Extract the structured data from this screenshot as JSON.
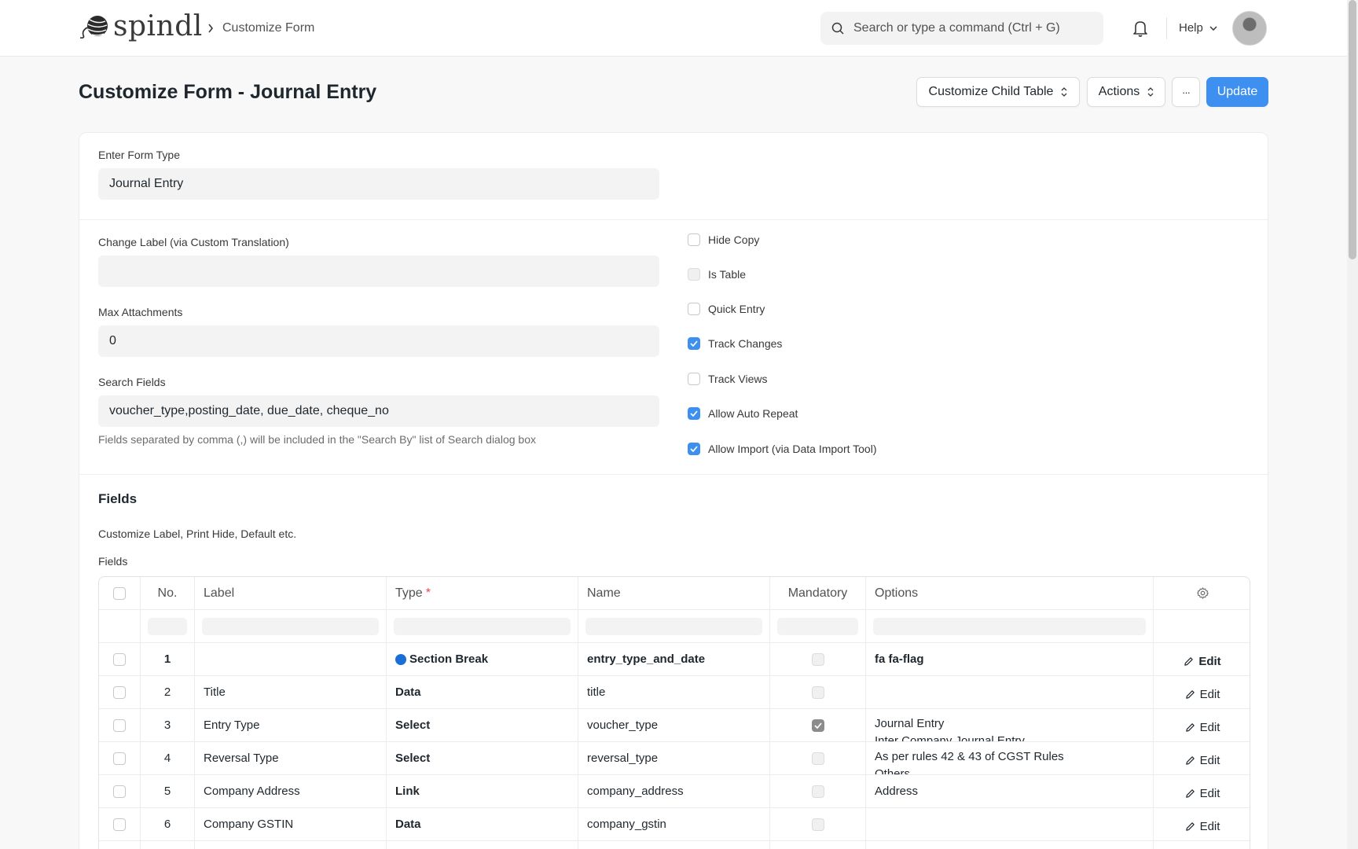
{
  "brand": {
    "name": "spindl"
  },
  "breadcrumb": {
    "current": "Customize Form"
  },
  "search": {
    "placeholder": "Search or type a command (Ctrl + G)"
  },
  "nav": {
    "help_label": "Help"
  },
  "page": {
    "title": "Customize Form - Journal Entry"
  },
  "toolbar": {
    "customize_child_table_label": "Customize Child Table",
    "actions_label": "Actions",
    "more_label": "···",
    "update_label": "Update"
  },
  "form": {
    "form_type_label": "Enter Form Type",
    "form_type_value": "Journal Entry",
    "change_label_label": "Change Label (via Custom Translation)",
    "change_label_value": "",
    "max_attachments_label": "Max Attachments",
    "max_attachments_value": "0",
    "search_fields_label": "Search Fields",
    "search_fields_value": "voucher_type,posting_date, due_date, cheque_no",
    "search_fields_hint": "Fields separated by comma (,) will be included in the \"Search By\" list of Search dialog box"
  },
  "checkboxes": [
    {
      "label": "Hide Copy",
      "checked": false,
      "disabled": false
    },
    {
      "label": "Is Table",
      "checked": false,
      "disabled": true
    },
    {
      "label": "Quick Entry",
      "checked": false,
      "disabled": false
    },
    {
      "label": "Track Changes",
      "checked": true,
      "disabled": false
    },
    {
      "label": "Track Views",
      "checked": false,
      "disabled": false
    },
    {
      "label": "Allow Auto Repeat",
      "checked": true,
      "disabled": false
    },
    {
      "label": "Allow Import (via Data Import Tool)",
      "checked": true,
      "disabled": false
    }
  ],
  "fields_section": {
    "title": "Fields",
    "description": "Customize Label, Print Hide, Default etc.",
    "grid_label": "Fields"
  },
  "table": {
    "columns": {
      "no": "No.",
      "label": "Label",
      "type": "Type",
      "type_required": "*",
      "name": "Name",
      "mandatory": "Mandatory",
      "options": "Options"
    },
    "edit_label": "Edit",
    "rows": [
      {
        "no": "1",
        "label": "",
        "type": "Section Break",
        "name": "entry_type_and_date",
        "mandatory": false,
        "options": [
          "fa fa-flag"
        ]
      },
      {
        "no": "2",
        "label": "Title",
        "type": "Data",
        "name": "title",
        "mandatory": false,
        "options": []
      },
      {
        "no": "3",
        "label": "Entry Type",
        "type": "Select",
        "name": "voucher_type",
        "mandatory": true,
        "options": [
          "Journal Entry",
          "Inter Company Journal Entry"
        ]
      },
      {
        "no": "4",
        "label": "Reversal Type",
        "type": "Select",
        "name": "reversal_type",
        "mandatory": false,
        "options": [
          "As per rules 42 & 43 of CGST Rules",
          "Others"
        ]
      },
      {
        "no": "5",
        "label": "Company Address",
        "type": "Link",
        "name": "company_address",
        "mandatory": false,
        "options": [
          "Address"
        ]
      },
      {
        "no": "6",
        "label": "Company GSTIN",
        "type": "Data",
        "name": "company_gstin",
        "mandatory": false,
        "options": []
      }
    ]
  },
  "colors": {
    "accent": "#3d8ff0",
    "section_dot": "#1a6fd6",
    "required": "#e24c4c"
  }
}
